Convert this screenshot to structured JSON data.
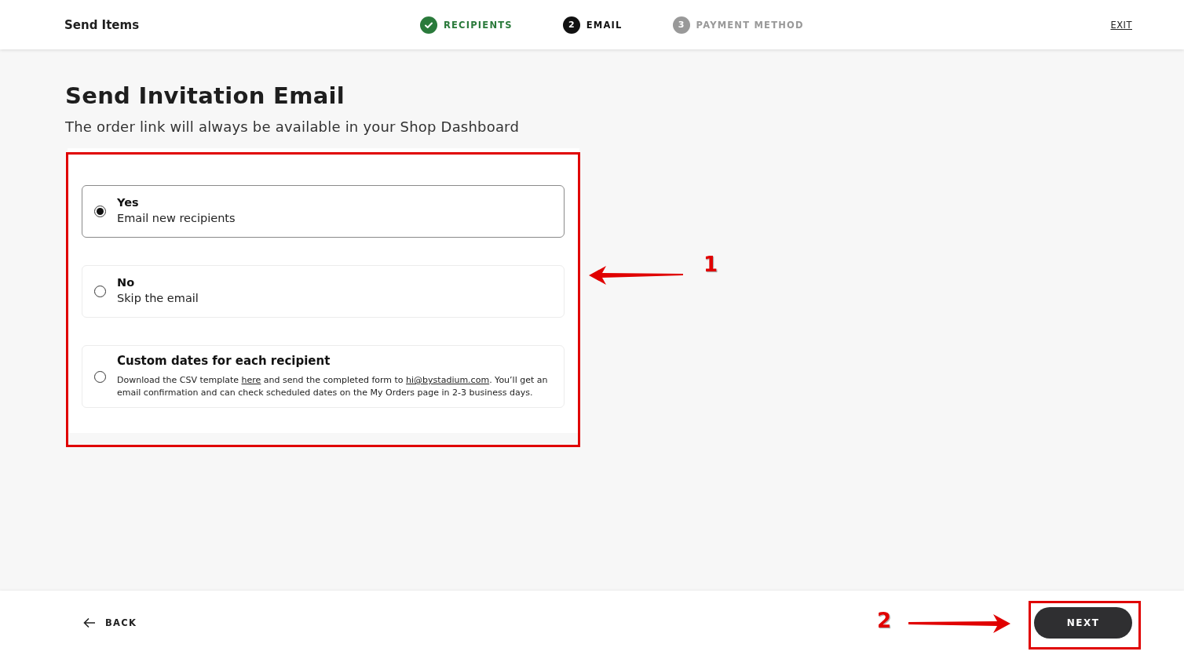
{
  "header": {
    "title": "Send Items",
    "exit": "EXIT"
  },
  "steps": [
    {
      "label": "RECIPIENTS",
      "kind": "done"
    },
    {
      "number": "2",
      "label": "EMAIL",
      "kind": "current"
    },
    {
      "number": "3",
      "label": "PAYMENT METHOD",
      "kind": "upcoming"
    }
  ],
  "heading": "Send Invitation Email",
  "subheading": "The order link will always be available in your Shop Dashboard",
  "options": [
    {
      "title": "Yes",
      "description": [
        {
          "kind": "text",
          "text": "Email new recipients"
        }
      ],
      "selected": true,
      "kind": "simple"
    },
    {
      "title": "No",
      "description": [
        {
          "kind": "text",
          "text": "Skip the email"
        }
      ],
      "selected": false,
      "kind": "simple"
    },
    {
      "title": "Custom dates for each recipient",
      "description": [
        {
          "kind": "text",
          "text": "Download the CSV template "
        },
        {
          "kind": "link",
          "text": "here"
        },
        {
          "kind": "text",
          "text": " and send the completed form to "
        },
        {
          "kind": "link",
          "text": "hi@bystadium.com"
        },
        {
          "kind": "text",
          "text": ". You’ll get an email confirmation and can check scheduled dates on the My Orders page in 2-3 business days."
        }
      ],
      "selected": false,
      "kind": "detailed"
    }
  ],
  "footer": {
    "back": "BACK",
    "next": "NEXT"
  },
  "annotations": [
    {
      "kind": "options",
      "number": "1"
    },
    {
      "kind": "next",
      "number": "2"
    }
  ]
}
